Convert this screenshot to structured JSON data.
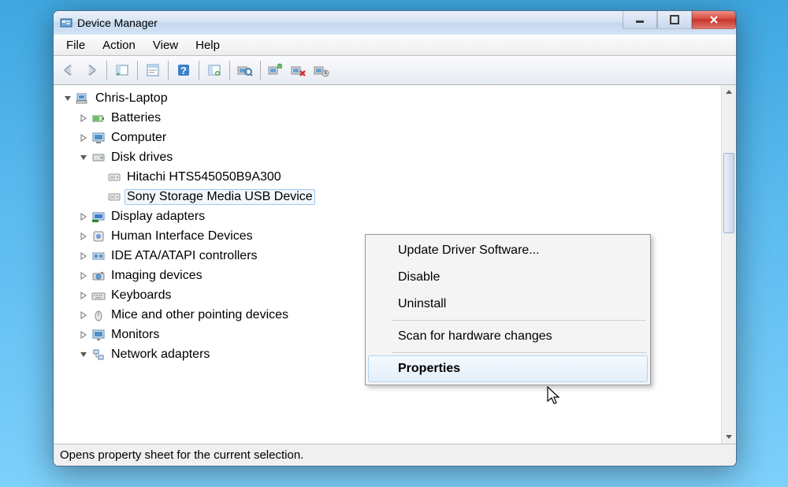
{
  "title": "Device Manager",
  "menubar": [
    "File",
    "Action",
    "View",
    "Help"
  ],
  "toolbar_buttons": [
    "back",
    "forward",
    "||",
    "show-hide-tree",
    "||",
    "properties-dialog",
    "||",
    "help",
    "||",
    "update-driver",
    "||",
    "scan-hardware",
    "||",
    "uninstall",
    "enable",
    "disable"
  ],
  "tree": {
    "root": {
      "label": "Chris-Laptop",
      "expanded": true,
      "icon": "computer"
    },
    "children": [
      {
        "label": "Batteries",
        "icon": "battery",
        "expandable": true
      },
      {
        "label": "Computer",
        "icon": "computer-monitor",
        "expandable": true
      },
      {
        "label": "Disk drives",
        "icon": "disk",
        "expandable": true,
        "expanded": true,
        "children": [
          {
            "label": "Hitachi HTS545050B9A300",
            "icon": "disk-drive"
          },
          {
            "label": "Sony Storage Media USB Device",
            "icon": "disk-drive",
            "selected": true
          }
        ]
      },
      {
        "label": "Display adapters",
        "icon": "display-adapter",
        "expandable": true
      },
      {
        "label": "Human Interface Devices",
        "icon": "hid",
        "expandable": true
      },
      {
        "label": "IDE ATA/ATAPI controllers",
        "icon": "ide",
        "expandable": true
      },
      {
        "label": "Imaging devices",
        "icon": "imaging",
        "expandable": true
      },
      {
        "label": "Keyboards",
        "icon": "keyboard",
        "expandable": true
      },
      {
        "label": "Mice and other pointing devices",
        "icon": "mouse",
        "expandable": true
      },
      {
        "label": "Monitors",
        "icon": "monitor",
        "expandable": true
      },
      {
        "label": "Network adapters",
        "icon": "network",
        "expandable": true,
        "expanded": true
      }
    ]
  },
  "context_menu": {
    "items": [
      {
        "label": "Update Driver Software...",
        "id": "update-driver"
      },
      {
        "label": "Disable",
        "id": "disable"
      },
      {
        "label": "Uninstall",
        "id": "uninstall"
      },
      {
        "sep": true
      },
      {
        "label": "Scan for hardware changes",
        "id": "scan"
      },
      {
        "sep": true
      },
      {
        "label": "Properties",
        "id": "properties",
        "highlighted": true
      }
    ]
  },
  "statusbar": "Opens property sheet for the current selection."
}
